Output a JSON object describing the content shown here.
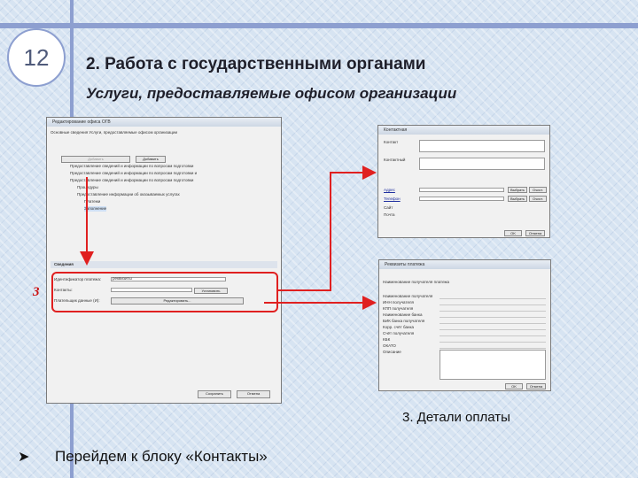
{
  "slide": {
    "number": "12",
    "title": "2. Работа с государственными органами",
    "subtitle": "Услуги, предоставляемые офисом организации",
    "caption": "3. Детали оплаты",
    "bullet": "Перейдем к блоку «Контакты»",
    "callout_number": "3"
  },
  "main_window": {
    "title": "Редактирование офиса ОГВ",
    "tabs": "Основные сведения   Услуги, предоставляемые офисом организации",
    "add_button": "Добавить",
    "tree_items": [
      "Предоставление сведений и информации по вопросам подготовки",
      "Предоставление сведений и информации по вопросам подготовки и",
      "Предоставление сведений и информации по вопросам подготовки",
      "Процедуры",
      "Предоставление информации об оказываемых услугах",
      "Платежи",
      "Заполнение"
    ],
    "section_title": "Сведения",
    "labels": [
      "Идентификатор платежа:",
      "Контакты:",
      "Плательщик данные (И):"
    ],
    "id_value": "реквизиты",
    "contacts_button": "Установить",
    "edit_button": "Редактировать...",
    "save_button": "Сохранить",
    "cancel_button": "Отмена"
  },
  "contact_window": {
    "title": "Контактная",
    "labels": [
      "Контакт",
      "Контактный",
      "Адрес",
      "Телефон",
      "Сайт",
      "Почта"
    ],
    "select_button": "Выбрать",
    "clear_button": "Очист.",
    "ok_button": "OK",
    "cancel_button": "Отмена"
  },
  "payment_window": {
    "title": "Реквизиты платежа",
    "labels": [
      "Наименование получателя платежа",
      "Наименование получателя",
      "ИНН получателя",
      "КПП получателя",
      "Наименование банка",
      "БИК банка получателя",
      "Корр. счёт банка",
      "Счёт получателя",
      "КБК",
      "ОКАТО",
      "Описание"
    ],
    "ok_button": "OK",
    "cancel_button": "Отмена"
  },
  "colors": {
    "accent": "#8d9fd0",
    "callout": "#e02020",
    "background": "#d7e4f2"
  }
}
